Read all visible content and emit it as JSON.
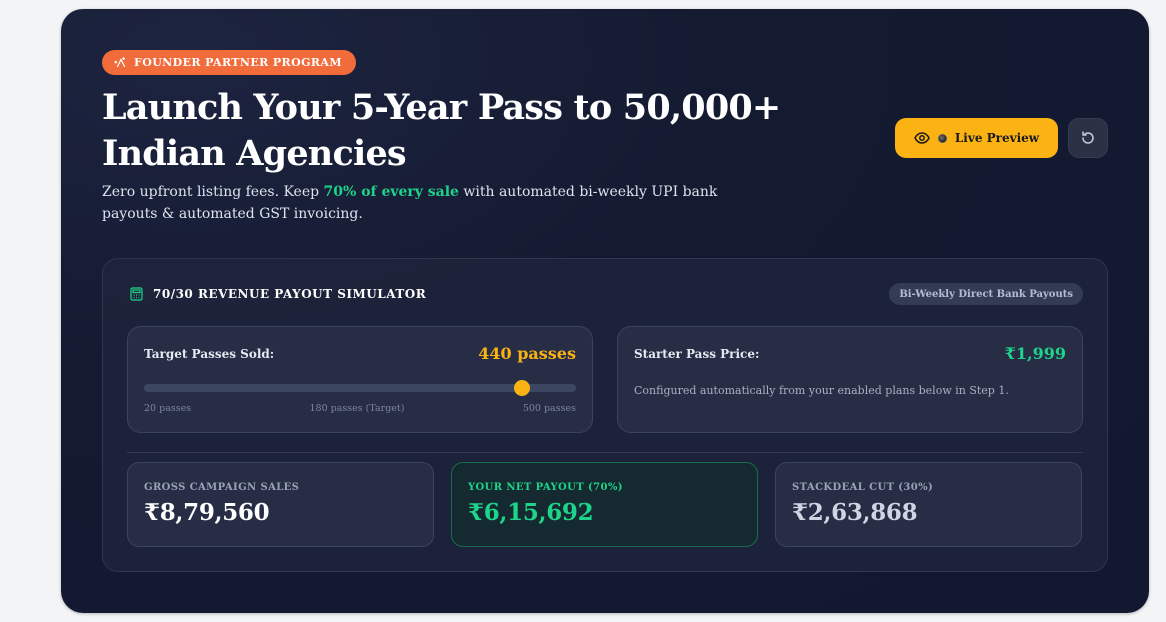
{
  "badge": {
    "label": "FOUNDER PARTNER PROGRAM",
    "icon": "sparkle-icon"
  },
  "hero": {
    "title_line1": "Launch Your 5-Year Pass to 50,000+",
    "title_line2": "Indian Agencies",
    "subtitle_pre": "Zero upfront listing fees. Keep ",
    "subtitle_highlight": "70% of every sale",
    "subtitle_post": " with automated bi-weekly UPI bank payouts & automated GST invoicing."
  },
  "actions": {
    "preview_label": "Live Preview",
    "preview_icon": "eye-icon",
    "reset_icon": "reset-icon"
  },
  "simulator": {
    "title": "70/30 REVENUE PAYOUT SIMULATOR",
    "icon": "calculator-icon",
    "tag": "Bi-Weekly Direct Bank Payouts",
    "passes": {
      "label": "Target Passes Sold:",
      "value_text": "440 passes",
      "value": 440,
      "min": 20,
      "max": 500,
      "tick_min": "20 passes",
      "tick_mid": "180 passes (Target)",
      "tick_max": "500 passes"
    },
    "price": {
      "label": "Starter Pass Price:",
      "value_text": "₹1,999",
      "note": "Configured automatically from your enabled plans below in Step 1."
    },
    "stats": {
      "gross": {
        "caption": "GROSS CAMPAIGN SALES",
        "value": "₹8,79,560"
      },
      "net": {
        "caption": "YOUR NET PAYOUT (70%)",
        "value": "₹6,15,692"
      },
      "cut": {
        "caption": "STACKDEAL CUT (30%)",
        "value": "₹2,63,868"
      }
    }
  },
  "colors": {
    "accent_orange": "#f26b3a",
    "accent_amber": "#fbb313",
    "accent_green": "#1ed48a",
    "background": "#141a30"
  }
}
